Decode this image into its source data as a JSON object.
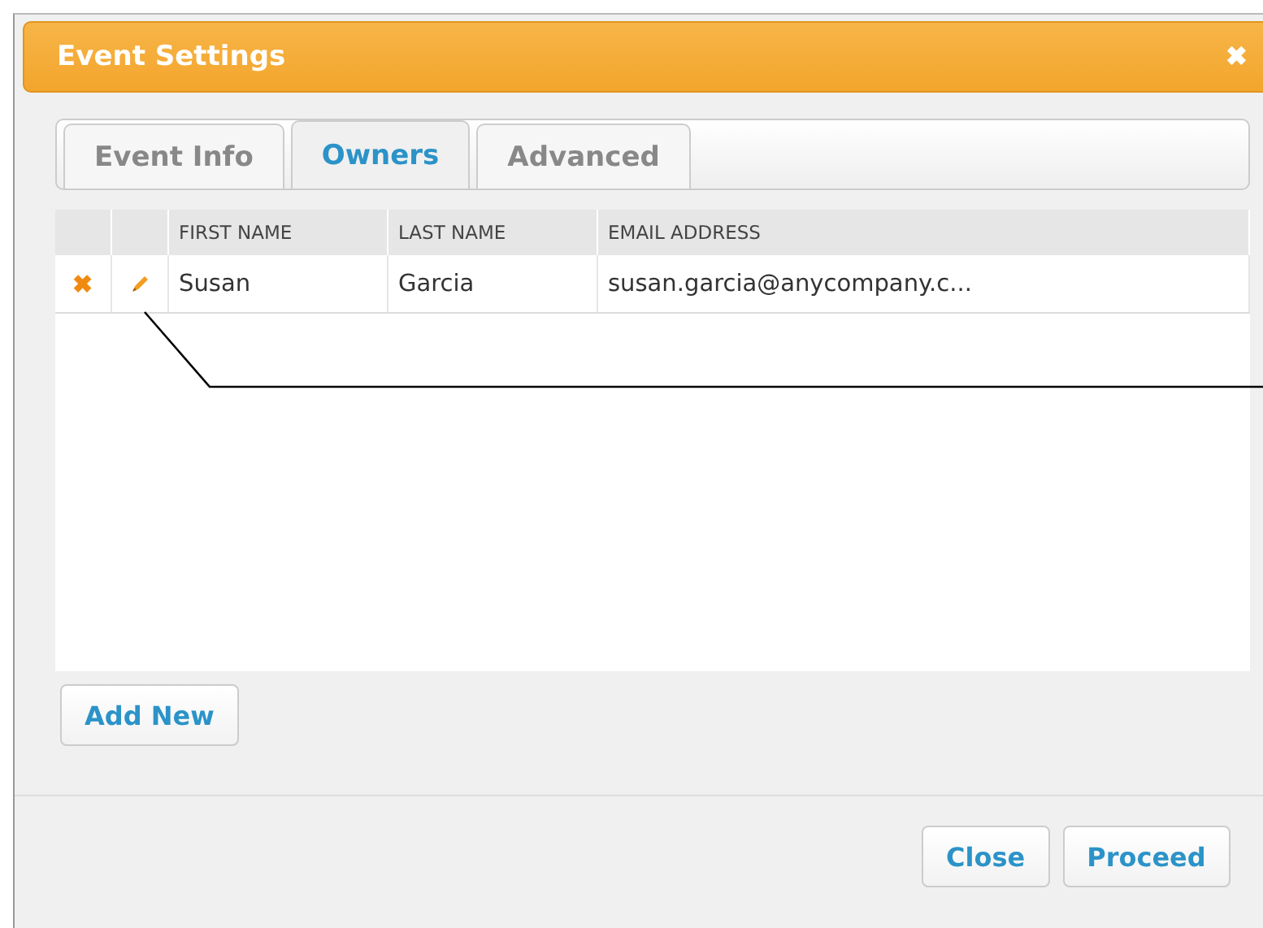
{
  "window": {
    "title": "Event Settings",
    "close": "✖"
  },
  "tabs": [
    {
      "label": "Event Info",
      "selected": false
    },
    {
      "label": "Owners",
      "selected": true
    },
    {
      "label": "Advanced",
      "selected": false
    }
  ],
  "table": {
    "columns": [
      "FIRST NAME",
      "LAST NAME",
      "EMAIL ADDRESS"
    ],
    "rows": [
      {
        "delete": "✖",
        "cells": [
          "Susan",
          "Garcia",
          "susan.garcia@anycompany.c..."
        ]
      }
    ]
  },
  "add_button": "Add New",
  "buttons": [
    "Close",
    "Proceed"
  ]
}
